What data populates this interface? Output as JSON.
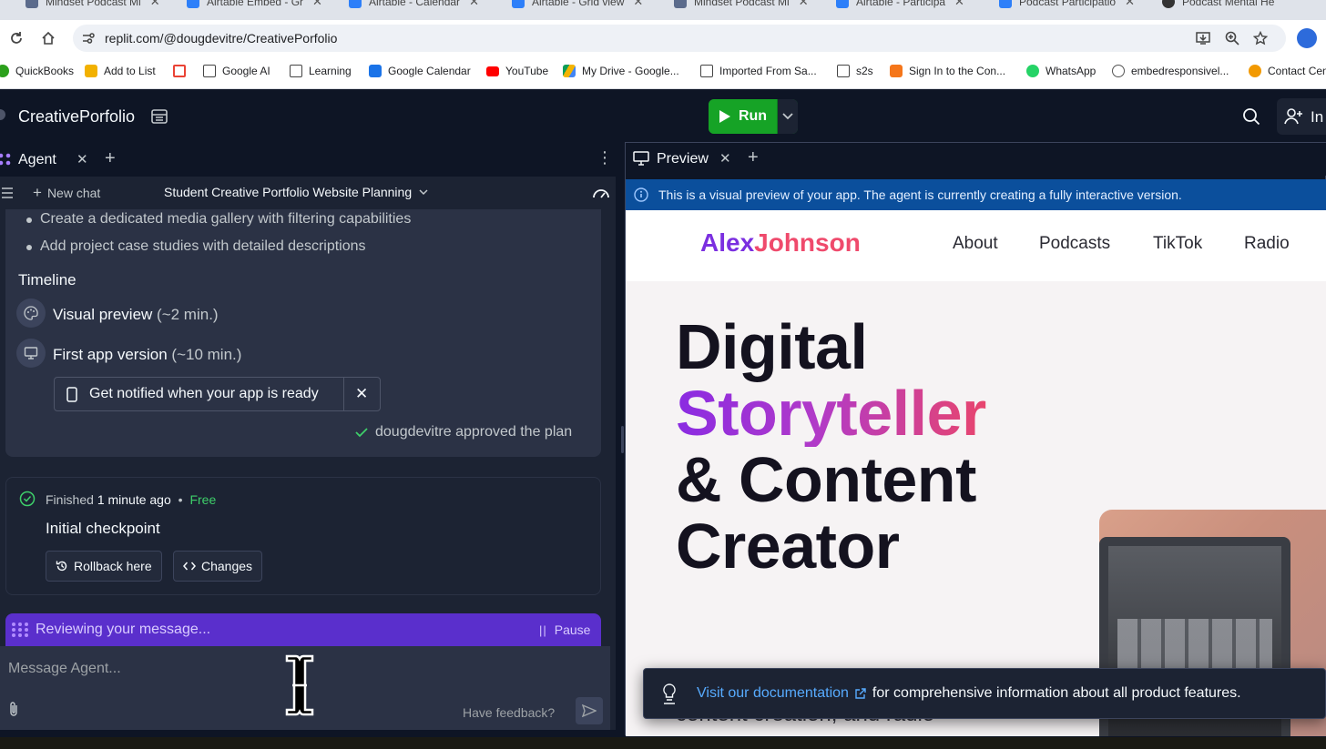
{
  "browser": {
    "tabs": [
      {
        "label": "Mindset Podcast Mi",
        "color": "#5b6b8c"
      },
      {
        "label": "Airtable Embed - Gr",
        "color": "#2d7ff9"
      },
      {
        "label": "Airtable - Calendar",
        "color": "#2d7ff9"
      },
      {
        "label": "Airtable - Grid view",
        "color": "#2d7ff9"
      },
      {
        "label": "Mindset Podcast Mi",
        "color": "#5b6b8c"
      },
      {
        "label": "Airtable - Participa",
        "color": "#2d7ff9"
      },
      {
        "label": "Podcast Participatio",
        "color": "#2d7ff9"
      },
      {
        "label": "Podcast Mental He",
        "color": "#333333"
      }
    ],
    "url": "replit.com/@dougdevitre/CreativePorfolio",
    "bookmarks": [
      {
        "label": "QuickBooks",
        "color": "#2ca01c"
      },
      {
        "label": "Add to List",
        "color": "#f2b100"
      },
      {
        "label": "",
        "color": "#ea4335"
      },
      {
        "label": "Google AI",
        "color": "folder"
      },
      {
        "label": "Learning",
        "color": "folder"
      },
      {
        "label": "Google Calendar",
        "color": "#1a73e8"
      },
      {
        "label": "YouTube",
        "color": "#ff0000"
      },
      {
        "label": "My Drive - Google...",
        "color": "#0f9d58"
      },
      {
        "label": "Imported From Sa...",
        "color": "folder"
      },
      {
        "label": "s2s",
        "color": "folder"
      },
      {
        "label": "Sign In to the Con...",
        "color": "#f5761a"
      },
      {
        "label": "WhatsApp",
        "color": "#25d366"
      },
      {
        "label": "embedresponsivel...",
        "color": "#555555"
      },
      {
        "label": "Contact Cen",
        "color": "#f29900"
      }
    ]
  },
  "header": {
    "project_name": "CreativePorfolio",
    "run_label": "Run",
    "invite_label": "In"
  },
  "agent": {
    "tab_label": "Agent",
    "new_chat_label": "New chat",
    "chat_title": "Student Creative Portfolio Website Planning",
    "bullets": [
      "Create a dedicated media gallery with filtering capabilities",
      "Add project case studies with detailed descriptions"
    ],
    "timeline_heading": "Timeline",
    "timeline": [
      {
        "label": "Visual preview",
        "eta": "(~2 min.)"
      },
      {
        "label": "First app version",
        "eta": "(~10 min.)"
      }
    ],
    "notify_label": "Get notified when your app is ready",
    "approved_text": "dougdevitre approved the plan",
    "checkpoint": {
      "status": "Finished",
      "time": "1 minute ago",
      "separator": "•",
      "cost": "Free",
      "title": "Initial checkpoint",
      "rollback_label": "Rollback here",
      "changes_label": "Changes"
    },
    "reviewing_text": "Reviewing your message...",
    "pause_label": "Pause",
    "composer_placeholder": "Message Agent...",
    "feedback_label": "Have feedback?"
  },
  "preview": {
    "tab_label": "Preview",
    "banner_text": "This is a visual preview of your app. The agent is currently creating a fully interactive version.",
    "site": {
      "logo_first": "Alex",
      "logo_last": "Johnson",
      "nav": [
        "About",
        "Podcasts",
        "TikTok",
        "Radio"
      ],
      "hero_line1": "Digital",
      "hero_line2": "Storyteller",
      "hero_line3": "& Content",
      "hero_line4": "Creator",
      "subline": "content creation, and radio"
    },
    "tooltip_link": "Visit our documentation",
    "tooltip_text": "for comprehensive information about all product features."
  }
}
